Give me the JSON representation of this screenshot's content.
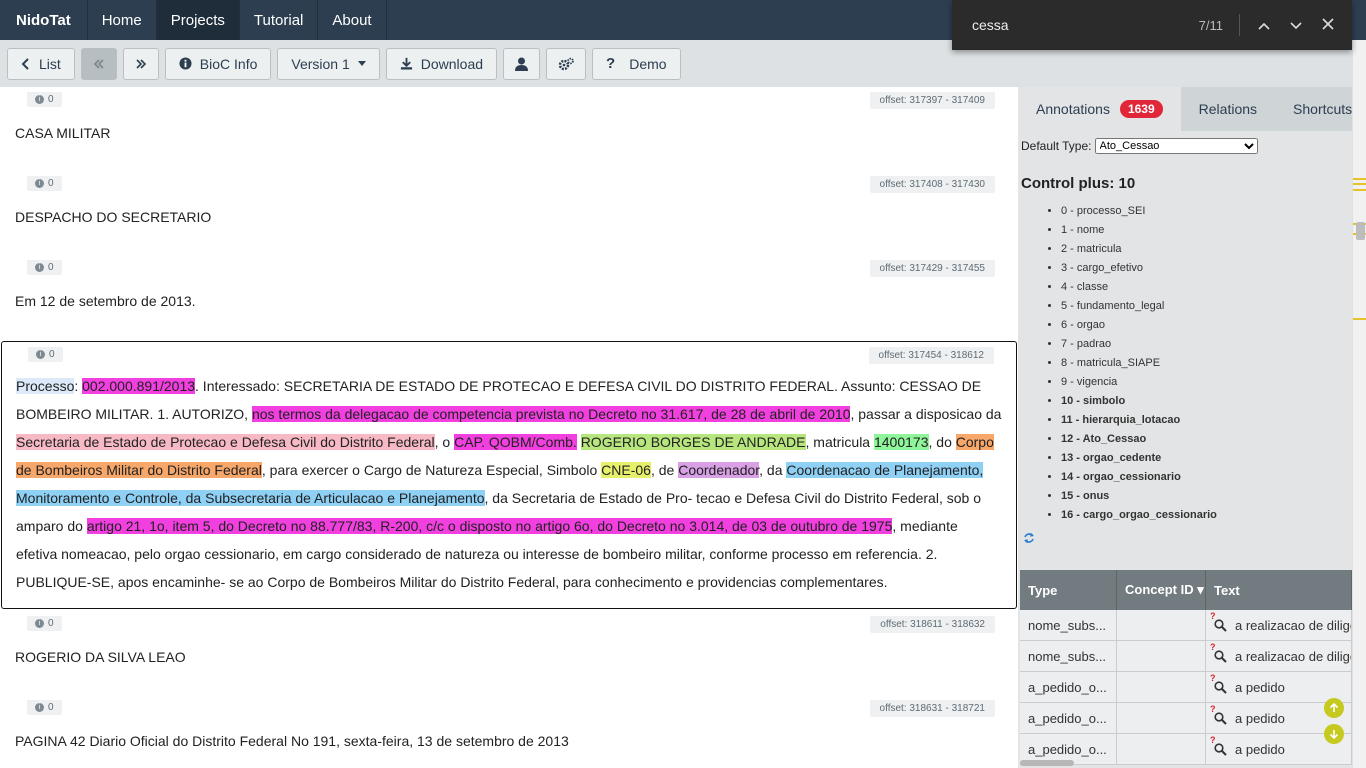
{
  "navbar": {
    "brand": "NidoTat",
    "items": [
      "Home",
      "Projects",
      "Tutorial",
      "About"
    ],
    "active": "Projects"
  },
  "find": {
    "query": "cessa",
    "count": "7/11"
  },
  "toolbar": {
    "list": "List",
    "bioc": "BioC Info",
    "version": "Version 1",
    "download": "Download",
    "demo": "Demo"
  },
  "passages": [
    {
      "count": "0",
      "offset": "offset: 317397 - 317409",
      "text": "CASA MILITAR"
    },
    {
      "count": "0",
      "offset": "offset: 317408 - 317430",
      "text": "DESPACHO DO SECRETARIO"
    },
    {
      "count": "0",
      "offset": "offset: 317429 - 317455",
      "text": "Em 12 de setembro de 2013."
    },
    {
      "count": "0",
      "offset": "offset: 317454 - 318612"
    },
    {
      "count": "0",
      "offset": "offset: 318611 - 318632",
      "text": "ROGERIO DA SILVA LEAO"
    },
    {
      "count": "0",
      "offset": "offset: 318631 - 318721",
      "text": "PAGINA 42 Diario Oficial do Distrito Federal No 191, sexta-feira, 13 de setembro de 2013"
    }
  ],
  "main_passage": {
    "seg0": "Processo",
    "seg1": ": ",
    "seg2": "002.000.891/2013",
    "seg3": ". Interessado: SECRETARIA DE ESTADO DE PROTECAO E DEFESA CIVIL DO DISTRITO FEDERAL. Assunto: CESSAO DE BOMBEIRO MILITAR. 1. AUTORIZO, ",
    "seg4": "nos termos da delegacao de competencia prevista no Decreto no 31.617, de 28 de abril de 2010",
    "seg5": ", passar a disposicao da ",
    "seg6": "Secretaria de Estado de Protecao e Defesa Civil do Distrito Federal",
    "seg7": ", o ",
    "seg8": "CAP. QOBM/Comb.",
    "seg9": " ",
    "seg10": "ROGERIO BORGES DE ANDRADE",
    "seg11": ", matricula ",
    "seg12": "1400173",
    "seg13": ", do ",
    "seg14": "Corpo de Bombeiros Militar do Distrito Federal",
    "seg15": ", para exercer o Cargo de Natureza Especial, Simbolo ",
    "seg16": "CNE-06",
    "seg17": ", de ",
    "seg18": "Coordenador",
    "seg19": ", da ",
    "seg20": "Coordenacao de Planejamento, Monitoramento e Controle, da Subsecretaria de Articulacao e Planejamento",
    "seg21": ", da Secretaria de Estado de Pro- tecao e Defesa Civil do Distrito Federal, sob o amparo do ",
    "seg22": "artigo 21, 1o, item 5, do Decreto no 88.777/83, R-200, c/c o disposto no artigo 6o, do Decreto no 3.014, de 03 de outubro de 1975",
    "seg23": ", mediante efetiva nomeacao, pelo orgao cessionario, em cargo considerado de natureza ou interesse de bombeiro militar, conforme processo em referencia. 2. PUBLIQUE-SE, apos encaminhe- se ao Corpo de Bombeiros Militar do Distrito Federal, para conhecimento e providencias complementares."
  },
  "panel": {
    "tabs": [
      "Annotations",
      "Relations",
      "Shortcuts"
    ],
    "annotation_count": "1639",
    "default_type_label": "Default Type:",
    "default_type_value": "Ato_Cessao",
    "control_title": "Control plus: 10",
    "types": [
      "0 - processo_SEI",
      "1 - nome",
      "2 - matricula",
      "3 - cargo_efetivo",
      "4 - classe",
      "5 - fundamento_legal",
      "6 - orgao",
      "7 - padrao",
      "8 - matricula_SIAPE",
      "9 - vigencia",
      "10 - simbolo",
      "11 - hierarquia_lotacao",
      "12 - Ato_Cessao",
      "13 - orgao_cedente",
      "14 - orgao_cessionario",
      "15 - onus",
      "16 - cargo_orgao_cessionario"
    ],
    "table": {
      "headers": [
        "Type",
        "Concept ID ▾",
        "Text"
      ],
      "rows": [
        {
          "type": "nome_subs...",
          "concept": "",
          "text": "a realizacao de diligen"
        },
        {
          "type": "nome_subs...",
          "concept": "",
          "text": "a realizacao de diligen"
        },
        {
          "type": "a_pedido_o...",
          "concept": "",
          "text": "a pedido"
        },
        {
          "type": "a_pedido_o...",
          "concept": "",
          "text": "a pedido"
        },
        {
          "type": "a_pedido_o...",
          "concept": "",
          "text": "a pedido"
        }
      ]
    }
  },
  "colors": {
    "navbar": "#2c3e50",
    "badge": "#e2263a",
    "highlight_magenta": "#f23fe0",
    "highlight_blue": "#8fd0f5"
  }
}
